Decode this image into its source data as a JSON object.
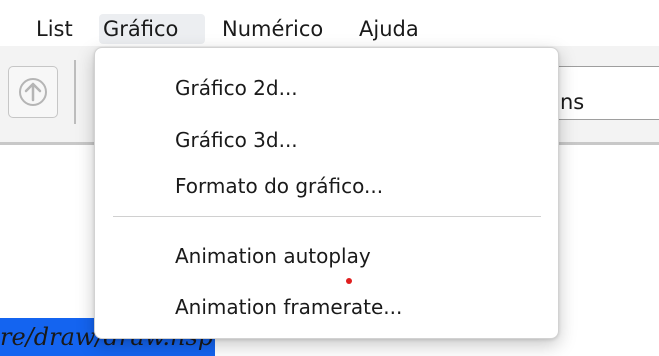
{
  "menubar": {
    "items": [
      {
        "label": "List"
      },
      {
        "label": "Gráfico",
        "active": true
      },
      {
        "label": "Numérico"
      },
      {
        "label": "Ajuda"
      }
    ]
  },
  "toolbar": {
    "up_icon": "arrow-up-icon",
    "field_text_fragment": "ns"
  },
  "document": {
    "path_text": "re/draw/draw.nsp"
  },
  "dropdown": {
    "group1": [
      {
        "label": "Gráfico 2d..."
      },
      {
        "label": "Gráfico 3d..."
      },
      {
        "label": "Formato do gráfico..."
      }
    ],
    "group2": [
      {
        "label": "Animation autoplay"
      },
      {
        "label": "Animation framerate..."
      }
    ]
  },
  "colors": {
    "selection_blue": "#1464f0",
    "active_menu_bg": "#eceef1",
    "cursor_dot": "#e01e1e"
  }
}
